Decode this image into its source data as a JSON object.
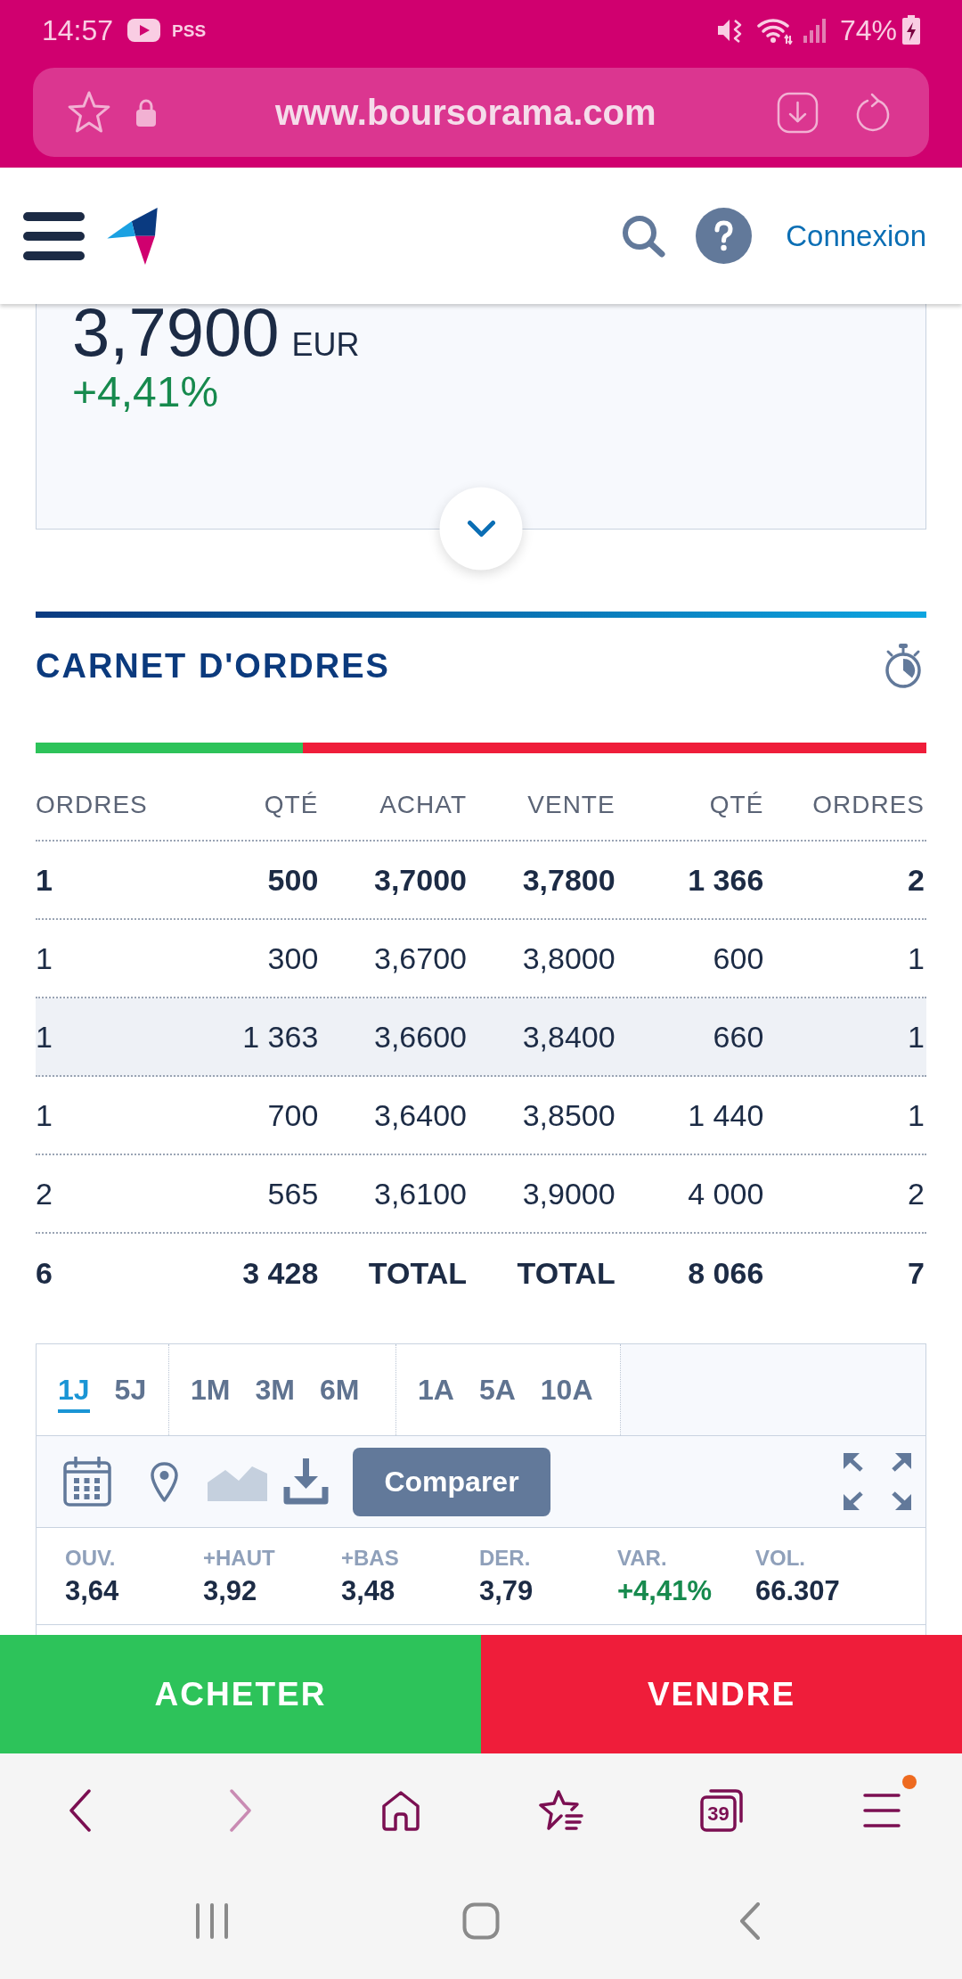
{
  "status_bar": {
    "time": "14:57",
    "app_label": "PSS",
    "battery": "74%"
  },
  "address_bar": {
    "url": "www.boursorama.com"
  },
  "site_header": {
    "login": "Connexion"
  },
  "quote": {
    "price": "3,7900",
    "currency": "EUR",
    "change": "+4,41%"
  },
  "order_book": {
    "title": "CARNET D'ORDRES",
    "balance": {
      "level": 0.3
    },
    "columns": [
      "ORDRES",
      "QTÉ",
      "ACHAT",
      "VENTE",
      "QTÉ",
      "ORDRES"
    ],
    "rows": [
      {
        "kind": "best",
        "highlighted": false,
        "cells": [
          "1",
          "500",
          "3,7000",
          "3,7800",
          "1 366",
          "2"
        ]
      },
      {
        "kind": "level",
        "highlighted": false,
        "cells": [
          "1",
          "300",
          "3,6700",
          "3,8000",
          "600",
          "1"
        ]
      },
      {
        "kind": "level",
        "highlighted": true,
        "cells": [
          "1",
          "1 363",
          "3,6600",
          "3,8400",
          "660",
          "1"
        ]
      },
      {
        "kind": "level",
        "highlighted": false,
        "cells": [
          "1",
          "700",
          "3,6400",
          "3,8500",
          "1 440",
          "1"
        ]
      },
      {
        "kind": "level",
        "highlighted": false,
        "cells": [
          "2",
          "565",
          "3,6100",
          "3,9000",
          "4 000",
          "2"
        ]
      },
      {
        "kind": "total",
        "highlighted": false,
        "cells": [
          "6",
          "3 428",
          "TOTAL",
          "TOTAL",
          "8 066",
          "7"
        ]
      }
    ]
  },
  "chart_panel": {
    "period_groups": [
      [
        {
          "label": "1J",
          "selected": true
        },
        {
          "label": "5J",
          "selected": false
        }
      ],
      [
        {
          "label": "1M",
          "selected": false
        },
        {
          "label": "3M",
          "selected": false
        },
        {
          "label": "6M",
          "selected": false
        }
      ],
      [
        {
          "label": "1A",
          "selected": false
        },
        {
          "label": "5A",
          "selected": false
        },
        {
          "label": "10A",
          "selected": false
        }
      ]
    ],
    "compare": "Comparer",
    "stats": [
      {
        "label": "OUV.",
        "value": "3,64",
        "kind": "plain"
      },
      {
        "label": "+HAUT",
        "value": "3,92",
        "kind": "plain"
      },
      {
        "label": "+BAS",
        "value": "3,48",
        "kind": "plain"
      },
      {
        "label": "DER.",
        "value": "3,79",
        "kind": "plain"
      },
      {
        "label": "VAR.",
        "value": "+4,41%",
        "kind": "change"
      },
      {
        "label": "VOL.",
        "value": "66.307",
        "kind": "plain"
      }
    ]
  },
  "trade_buttons": [
    {
      "label": "ACHETER",
      "kind": "buy"
    },
    {
      "label": "VENDRE",
      "kind": "sell"
    }
  ],
  "browser_toolbar": [
    {
      "kind": "back",
      "disabled": false,
      "badge": false
    },
    {
      "kind": "forward",
      "disabled": true,
      "badge": false
    },
    {
      "kind": "home",
      "disabled": false,
      "badge": false
    },
    {
      "kind": "bookmarks",
      "disabled": false,
      "badge": false
    },
    {
      "kind": "tabs",
      "disabled": false,
      "badge": false,
      "count": "39"
    },
    {
      "kind": "menu",
      "disabled": false,
      "badge": true
    }
  ],
  "system_nav": [
    {
      "kind": "recents"
    },
    {
      "kind": "home"
    },
    {
      "kind": "back"
    }
  ]
}
